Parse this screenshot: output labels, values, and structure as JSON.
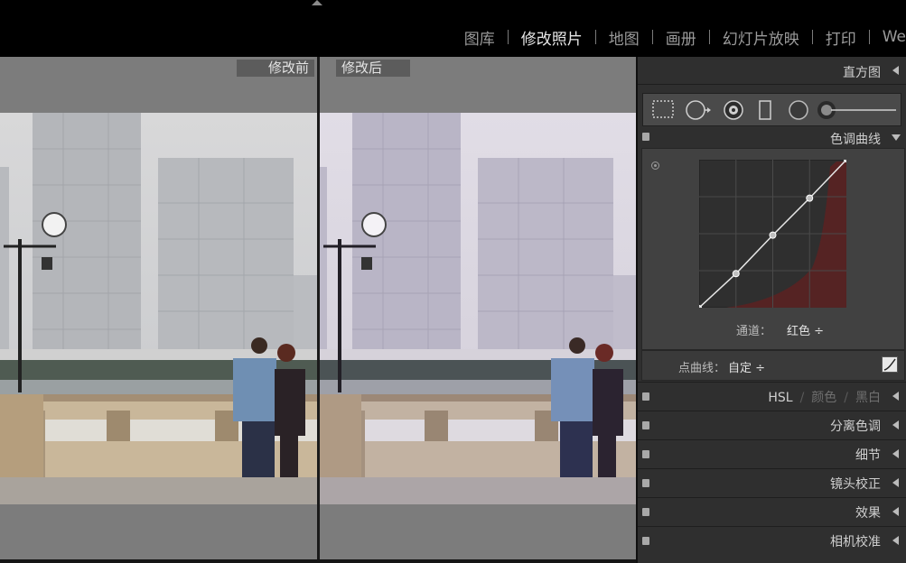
{
  "modules": [
    "图库",
    "修改照片",
    "地图",
    "画册",
    "幻灯片放映",
    "打印",
    "We"
  ],
  "active_module": "修改照片",
  "compare": {
    "before_label": "修改前",
    "after_label": "修改后"
  },
  "panel": {
    "histogram_title": "直方图",
    "tone_curve": {
      "title": "色调曲线",
      "channel_label": "通道：",
      "channel_value": "红色 ÷",
      "point_curve_label": "点曲线：",
      "point_curve_value": "自定 ÷",
      "curve_points": [
        [
          0,
          0
        ],
        [
          0.25,
          0.23
        ],
        [
          0.5,
          0.49
        ],
        [
          0.75,
          0.74
        ],
        [
          1,
          1
        ]
      ]
    },
    "hsl": {
      "hsl": "HSL",
      "color": "颜色",
      "bw": "黑白"
    },
    "sections": [
      "分离色调",
      "细节",
      "镜头校正",
      "效果",
      "相机校准"
    ]
  },
  "colors": {
    "panel_bg": "#2f2f2f",
    "compare_bg": "#7c7c7c",
    "curve_line": "#e6e6e6",
    "red_histogram": "#6a2424"
  }
}
